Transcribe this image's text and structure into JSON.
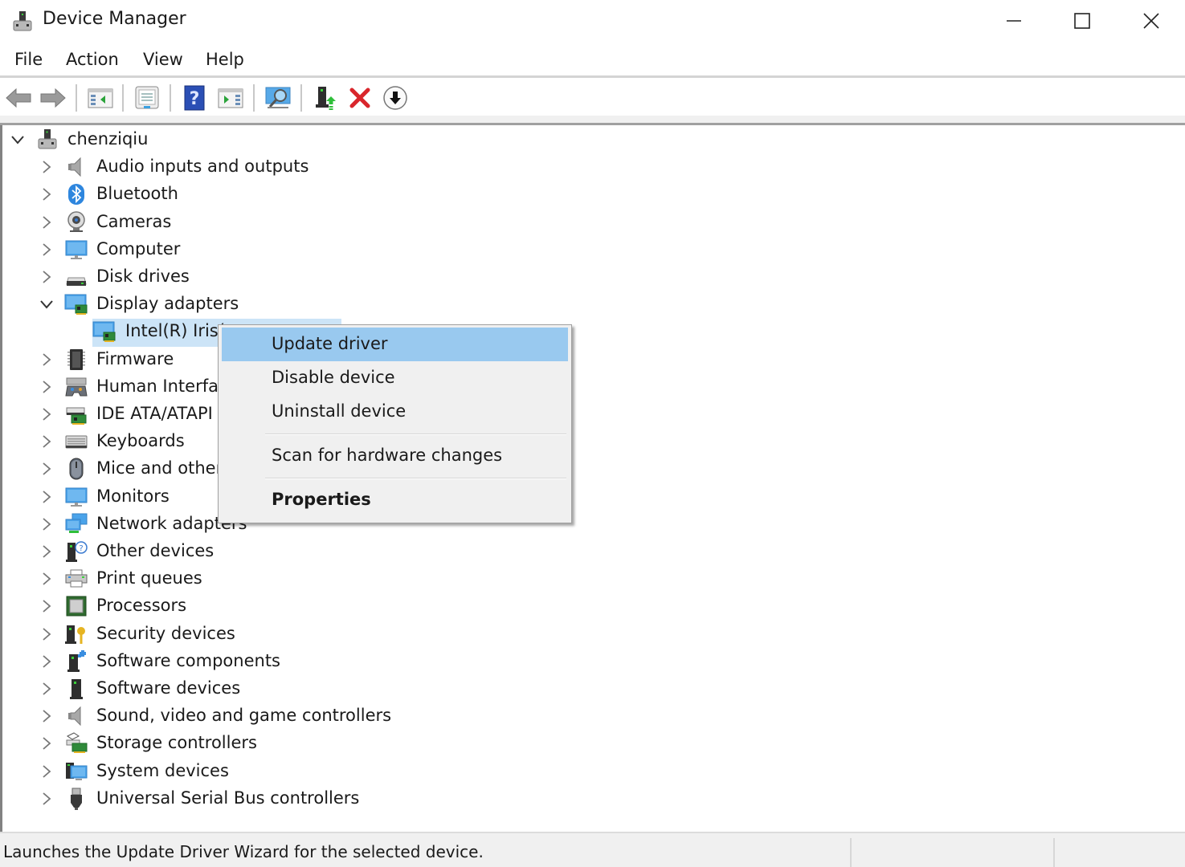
{
  "window": {
    "title": "Device Manager",
    "icon": "device-manager-icon",
    "controls": [
      "minimize",
      "maximize",
      "close"
    ]
  },
  "menubar": {
    "items": [
      {
        "label": "File"
      },
      {
        "label": "Action"
      },
      {
        "label": "View"
      },
      {
        "label": "Help"
      }
    ]
  },
  "toolbar": {
    "buttons": [
      {
        "name": "back",
        "icon": "back-arrow-icon"
      },
      {
        "name": "forward",
        "icon": "forward-arrow-icon"
      },
      {
        "name": "show-hide-console-tree",
        "icon": "console-tree-icon"
      },
      {
        "name": "properties",
        "icon": "properties-sheet-icon"
      },
      {
        "name": "help",
        "icon": "help-icon"
      },
      {
        "name": "show-hide-action-pane",
        "icon": "action-pane-icon"
      },
      {
        "name": "scan-hardware",
        "icon": "scan-monitor-icon"
      },
      {
        "name": "update-driver",
        "icon": "update-driver-icon"
      },
      {
        "name": "uninstall-device",
        "icon": "red-x-icon"
      },
      {
        "name": "disable-device",
        "icon": "down-arrow-circle-icon"
      }
    ]
  },
  "tree": {
    "root": {
      "label": "chenziqiu",
      "expanded": true,
      "icon": "computer-root-icon"
    },
    "categories": [
      {
        "label": "Audio inputs and outputs",
        "icon": "speaker-icon",
        "expanded": false
      },
      {
        "label": "Bluetooth",
        "icon": "bluetooth-icon",
        "expanded": false
      },
      {
        "label": "Cameras",
        "icon": "webcam-icon",
        "expanded": false
      },
      {
        "label": "Computer",
        "icon": "monitor-icon",
        "expanded": false
      },
      {
        "label": "Disk drives",
        "icon": "disk-drive-icon",
        "expanded": false
      },
      {
        "label": "Display adapters",
        "icon": "display-adapter-icon",
        "expanded": true,
        "children": [
          {
            "label": "Intel(R) Iris(",
            "icon": "display-adapter-icon",
            "selected": true
          }
        ]
      },
      {
        "label": "Firmware",
        "icon": "chip-icon",
        "expanded": false
      },
      {
        "label": "Human Interfa",
        "icon": "hid-icon",
        "expanded": false
      },
      {
        "label": "IDE ATA/ATAPI",
        "icon": "ide-controller-icon",
        "expanded": false
      },
      {
        "label": "Keyboards",
        "icon": "keyboard-icon",
        "expanded": false
      },
      {
        "label": "Mice and other",
        "icon": "mouse-icon",
        "expanded": false
      },
      {
        "label": "Monitors",
        "icon": "monitor-icon",
        "expanded": false
      },
      {
        "label": "Network adapters",
        "icon": "network-icon",
        "expanded": false
      },
      {
        "label": "Other devices",
        "icon": "unknown-device-icon",
        "expanded": false
      },
      {
        "label": "Print queues",
        "icon": "printer-icon",
        "expanded": false
      },
      {
        "label": "Processors",
        "icon": "processor-icon",
        "expanded": false
      },
      {
        "label": "Security devices",
        "icon": "security-key-icon",
        "expanded": false
      },
      {
        "label": "Software components",
        "icon": "software-component-icon",
        "expanded": false
      },
      {
        "label": "Software devices",
        "icon": "software-device-icon",
        "expanded": false
      },
      {
        "label": "Sound, video and game controllers",
        "icon": "speaker-icon",
        "expanded": false
      },
      {
        "label": "Storage controllers",
        "icon": "storage-controller-icon",
        "expanded": false
      },
      {
        "label": "System devices",
        "icon": "system-devices-icon",
        "expanded": false
      },
      {
        "label": "Universal Serial Bus controllers",
        "icon": "usb-icon",
        "expanded": false
      }
    ]
  },
  "context_menu": {
    "items": [
      {
        "label": "Update driver",
        "highlighted": true,
        "bold": false
      },
      {
        "label": "Disable device",
        "highlighted": false,
        "bold": false
      },
      {
        "label": "Uninstall device",
        "highlighted": false,
        "bold": false
      },
      {
        "separator": true
      },
      {
        "label": "Scan for hardware changes",
        "highlighted": false,
        "bold": false
      },
      {
        "separator": true
      },
      {
        "label": "Properties",
        "highlighted": false,
        "bold": true
      }
    ]
  },
  "statusbar": {
    "text": "Launches the Update Driver Wizard for the selected device."
  },
  "colors": {
    "menu_highlight": "#99c9ef",
    "tree_selection": "#cce4f7",
    "menu_background": "#f0f0f0",
    "uninstall_red": "#d9262c",
    "help_blue": "#1e3f9c"
  }
}
